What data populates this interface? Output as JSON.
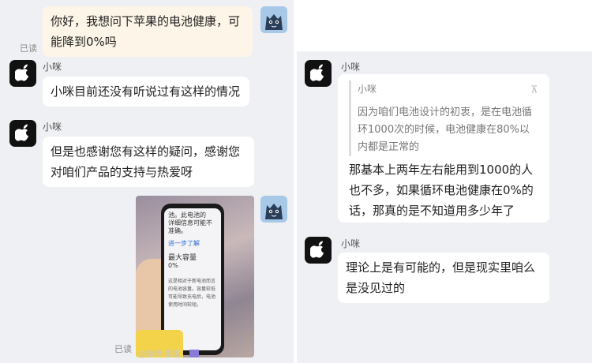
{
  "left": {
    "msg_user_1": "你好，我想问下苹果的电池健康，可能降到0%吗",
    "read_1": "已读",
    "agent_name": "小咪",
    "msg_agent_1": "小咪目前还没有听说过有这样的情况",
    "msg_agent_2": "但是也感谢您有这样的疑问，感谢您对咱们产品的支持与热爱呀",
    "read_2": "已读",
    "watermark": "@微博·蛋蛋"
  },
  "phone_screen": {
    "line1": "池。此电池的",
    "line2": "详细信息可能不",
    "line3": "准确。",
    "learn_more": "进一步了解",
    "capacity_label": "最大容量",
    "capacity_value": "0%",
    "note": "这是相对于新电池而言的电池容量。容量较低可能导致充电后，电池使用时间较短。"
  },
  "right": {
    "agent_name": "小咪",
    "quote_name": "小咪",
    "quote_text": "因为咱们电池设计的初衷，是在电池循环1000次的时候，电池健康在80%以内都是正常的",
    "reply_text": "那基本上两年左右能用到1000的人也不多，如果循环电池健康在0%的话，那真的是不知道用多少年了",
    "agent_name_2": "小咪",
    "msg_agent_3": "理论上是有可能的，但是现实里咱么是没见过的"
  },
  "colors": {
    "chat_bg": "#eef0f3",
    "bubble_agent": "#ffffff",
    "bubble_self": "#fdf6e8",
    "avatar_bg": "#111111",
    "link": "#2a6fd6"
  },
  "icons": {
    "apple_avatar": "apple-logo-icon",
    "user_avatar": "cartoon-cat-icon",
    "collapse_quote": "up-arrow-icon"
  }
}
